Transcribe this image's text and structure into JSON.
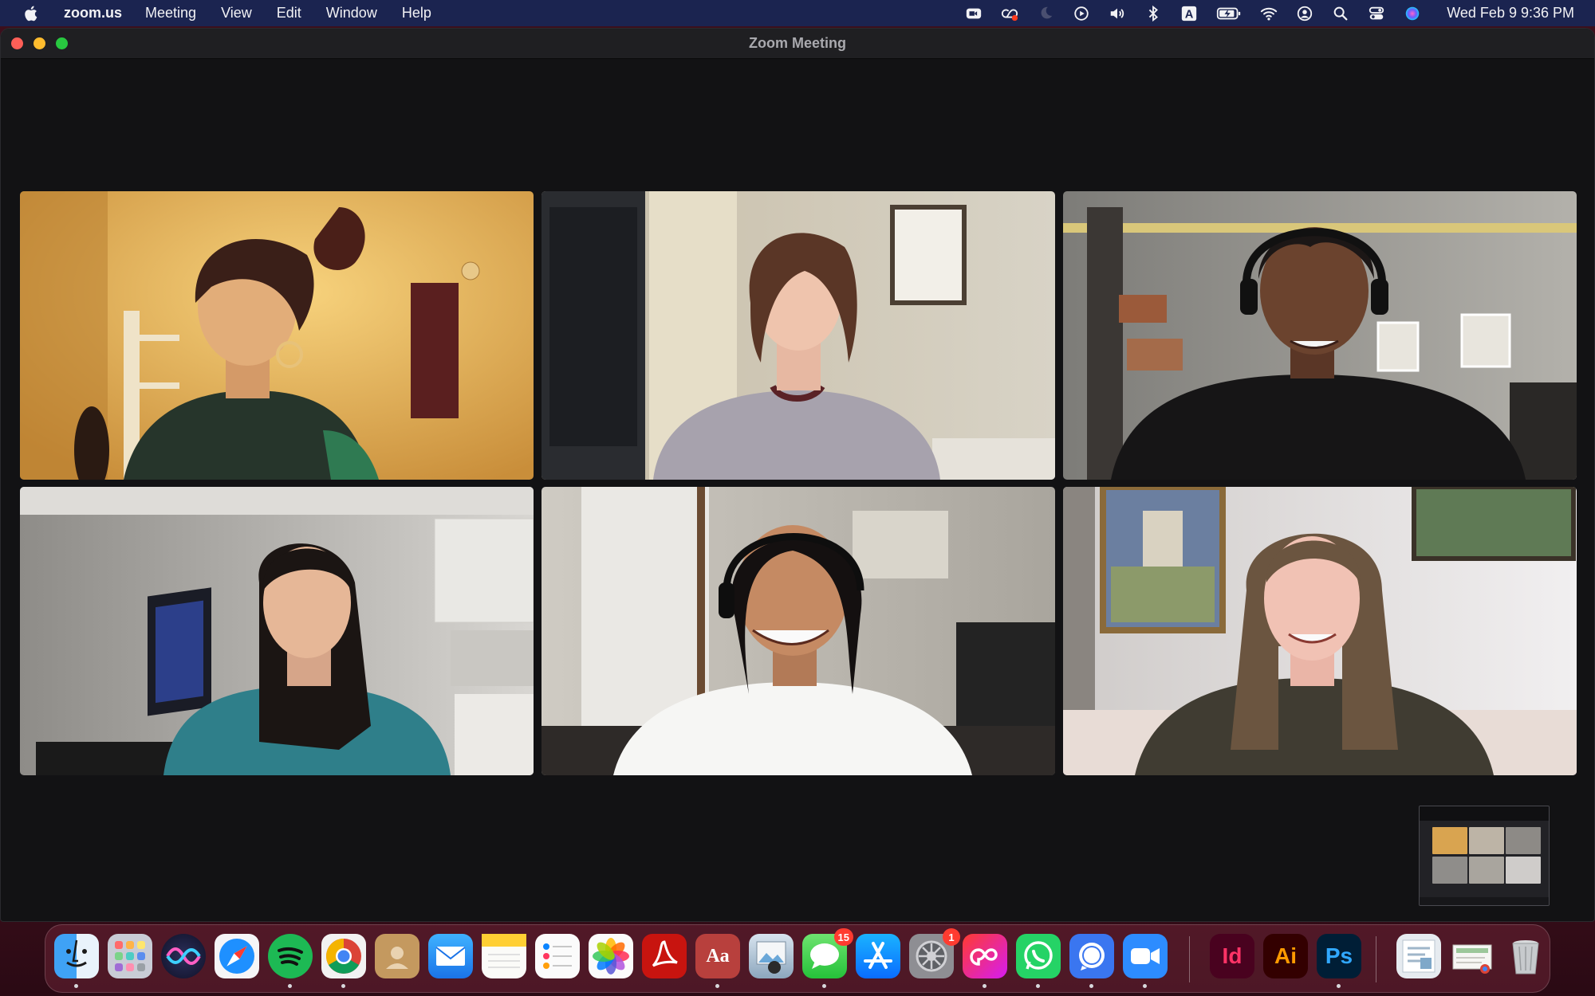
{
  "menubar": {
    "app_name": "zoom.us",
    "menus": [
      "Meeting",
      "View",
      "Edit",
      "Window",
      "Help"
    ],
    "status_icons": [
      "zoom-status-icon",
      "creative-cloud-sync-icon",
      "moon-icon",
      "play-circle-icon",
      "volume-icon",
      "bluetooth-icon",
      "input-source-icon",
      "battery-charging-icon",
      "wifi-icon",
      "user-account-icon",
      "spotlight-search-icon",
      "control-center-icon",
      "siri-icon"
    ],
    "input_source_letter": "A",
    "clock": "Wed Feb 9  9:36 PM"
  },
  "window": {
    "title": "Zoom Meeting"
  },
  "participants": [
    {
      "tile": 1,
      "background": "#e9b85a"
    },
    {
      "tile": 2,
      "background": "#cfc6b6"
    },
    {
      "tile": 3,
      "background": "#a8a6a0"
    },
    {
      "tile": 4,
      "background": "#b4b2ae"
    },
    {
      "tile": 5,
      "background": "#bdb9b2"
    },
    {
      "tile": 6,
      "background": "#e6e3e4"
    }
  ],
  "dock": {
    "apps": [
      {
        "name": "Finder",
        "icon": "finder-icon",
        "running": true
      },
      {
        "name": "Launchpad",
        "icon": "launchpad-icon",
        "running": false
      },
      {
        "name": "Siri",
        "icon": "siri-icon",
        "running": false
      },
      {
        "name": "Safari",
        "icon": "safari-icon",
        "running": false
      },
      {
        "name": "Spotify",
        "icon": "spotify-icon",
        "running": true
      },
      {
        "name": "Chrome",
        "icon": "chrome-icon",
        "running": true
      },
      {
        "name": "Contacts",
        "icon": "contacts-icon",
        "running": false
      },
      {
        "name": "Mail",
        "icon": "mail-icon",
        "running": false
      },
      {
        "name": "Notes",
        "icon": "notes-icon",
        "running": false
      },
      {
        "name": "Reminders",
        "icon": "reminders-icon",
        "running": false
      },
      {
        "name": "Photos",
        "icon": "photos-icon",
        "running": false
      },
      {
        "name": "Acrobat",
        "icon": "acrobat-icon",
        "running": false
      },
      {
        "name": "Dictionary",
        "icon": "dictionary-icon",
        "running": true,
        "label": "Aa"
      },
      {
        "name": "Preview",
        "icon": "preview-icon",
        "running": false
      },
      {
        "name": "Messages",
        "icon": "messages-icon",
        "running": true,
        "badge": "15"
      },
      {
        "name": "App Store",
        "icon": "app-store-icon",
        "running": false
      },
      {
        "name": "System Preferences",
        "icon": "system-preferences-icon",
        "running": false,
        "badge": "1"
      },
      {
        "name": "Creative Cloud",
        "icon": "creative-cloud-icon",
        "running": true
      },
      {
        "name": "WhatsApp",
        "icon": "whatsapp-icon",
        "running": true
      },
      {
        "name": "Signal",
        "icon": "signal-icon",
        "running": true
      },
      {
        "name": "Zoom",
        "icon": "zoom-icon",
        "running": true
      },
      {
        "name": "InDesign",
        "icon": "indesign-icon",
        "running": false,
        "label": "Id"
      },
      {
        "name": "Illustrator",
        "icon": "illustrator-icon",
        "running": false,
        "label": "Ai"
      },
      {
        "name": "Photoshop",
        "icon": "photoshop-icon",
        "running": true,
        "label": "Ps"
      }
    ],
    "stacks": [
      {
        "name": "Downloads stack",
        "icon": "downloads-stack-icon"
      },
      {
        "name": "Documents stack",
        "icon": "documents-stack-icon"
      },
      {
        "name": "Trash",
        "icon": "trash-icon"
      }
    ]
  }
}
